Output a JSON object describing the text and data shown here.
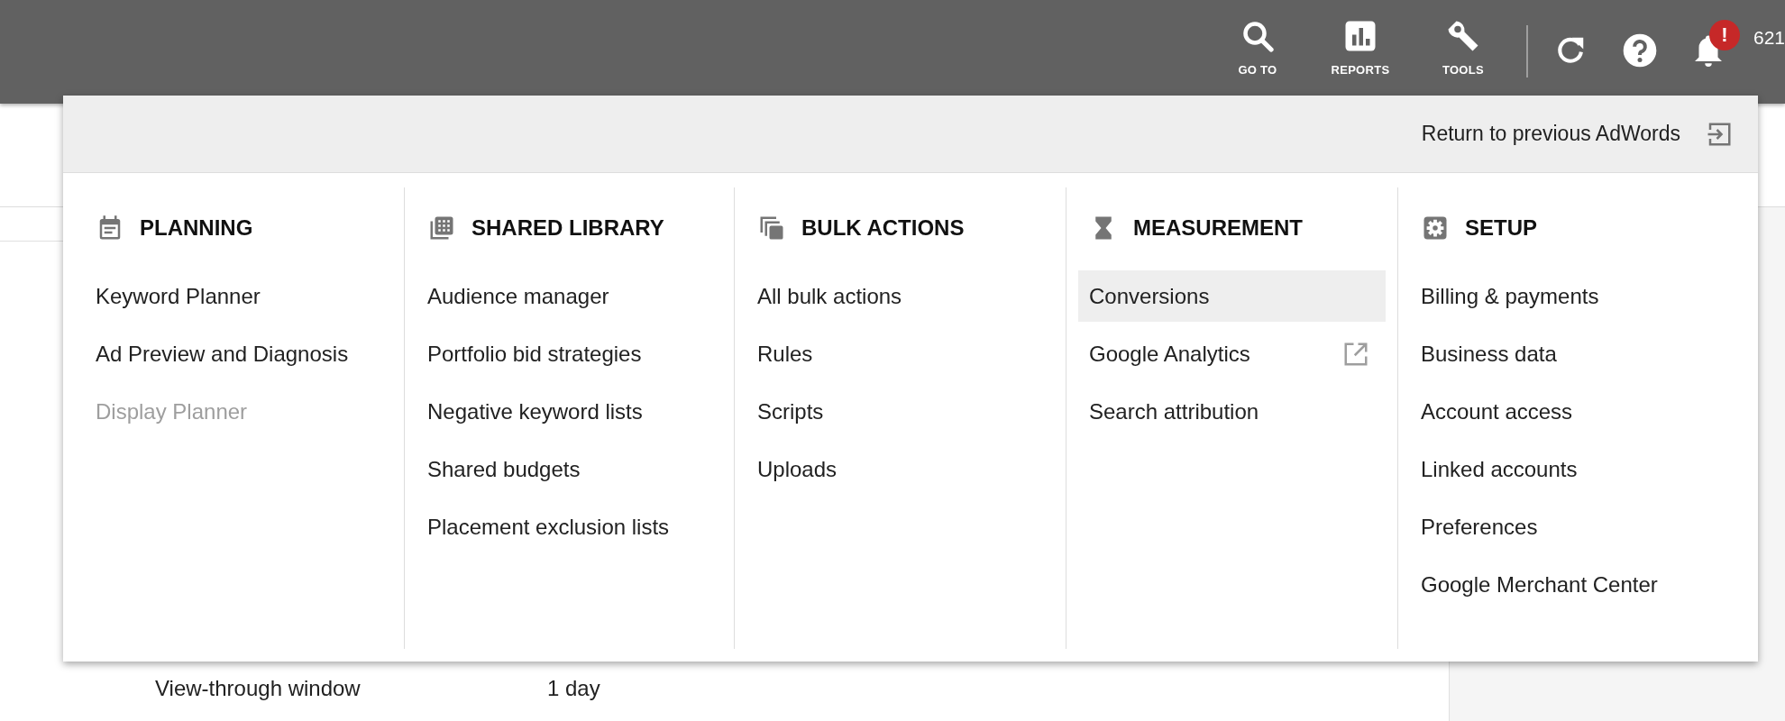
{
  "toolbar": {
    "tools": [
      {
        "label": "GO TO"
      },
      {
        "label": "REPORTS"
      },
      {
        "label": "TOOLS"
      }
    ],
    "notification_badge": "!",
    "account_number": "621"
  },
  "menu": {
    "return_link": "Return to previous AdWords",
    "columns": [
      {
        "title": "PLANNING",
        "items": [
          {
            "label": "Keyword Planner",
            "selected": false,
            "disabled": false,
            "external": false
          },
          {
            "label": "Ad Preview and Diagnosis",
            "selected": false,
            "disabled": false,
            "external": false
          },
          {
            "label": "Display Planner",
            "selected": false,
            "disabled": true,
            "external": false
          }
        ]
      },
      {
        "title": "SHARED LIBRARY",
        "items": [
          {
            "label": "Audience manager",
            "selected": false,
            "disabled": false,
            "external": false
          },
          {
            "label": "Portfolio bid strategies",
            "selected": false,
            "disabled": false,
            "external": false
          },
          {
            "label": "Negative keyword lists",
            "selected": false,
            "disabled": false,
            "external": false
          },
          {
            "label": "Shared budgets",
            "selected": false,
            "disabled": false,
            "external": false
          },
          {
            "label": "Placement exclusion lists",
            "selected": false,
            "disabled": false,
            "external": false
          }
        ]
      },
      {
        "title": "BULK ACTIONS",
        "items": [
          {
            "label": "All bulk actions",
            "selected": false,
            "disabled": false,
            "external": false
          },
          {
            "label": "Rules",
            "selected": false,
            "disabled": false,
            "external": false
          },
          {
            "label": "Scripts",
            "selected": false,
            "disabled": false,
            "external": false
          },
          {
            "label": "Uploads",
            "selected": false,
            "disabled": false,
            "external": false
          }
        ]
      },
      {
        "title": "MEASUREMENT",
        "items": [
          {
            "label": "Conversions",
            "selected": true,
            "disabled": false,
            "external": false
          },
          {
            "label": "Google Analytics",
            "selected": false,
            "disabled": false,
            "external": true
          },
          {
            "label": "Search attribution",
            "selected": false,
            "disabled": false,
            "external": false
          }
        ]
      },
      {
        "title": "SETUP",
        "items": [
          {
            "label": "Billing & payments",
            "selected": false,
            "disabled": false,
            "external": false
          },
          {
            "label": "Business data",
            "selected": false,
            "disabled": false,
            "external": false
          },
          {
            "label": "Account access",
            "selected": false,
            "disabled": false,
            "external": false
          },
          {
            "label": "Linked accounts",
            "selected": false,
            "disabled": false,
            "external": false
          },
          {
            "label": "Preferences",
            "selected": false,
            "disabled": false,
            "external": false
          },
          {
            "label": "Google Merchant Center",
            "selected": false,
            "disabled": false,
            "external": false
          }
        ]
      }
    ]
  },
  "settings": {
    "rows": [
      {
        "label": "View-through window",
        "value": "1 day"
      }
    ]
  }
}
